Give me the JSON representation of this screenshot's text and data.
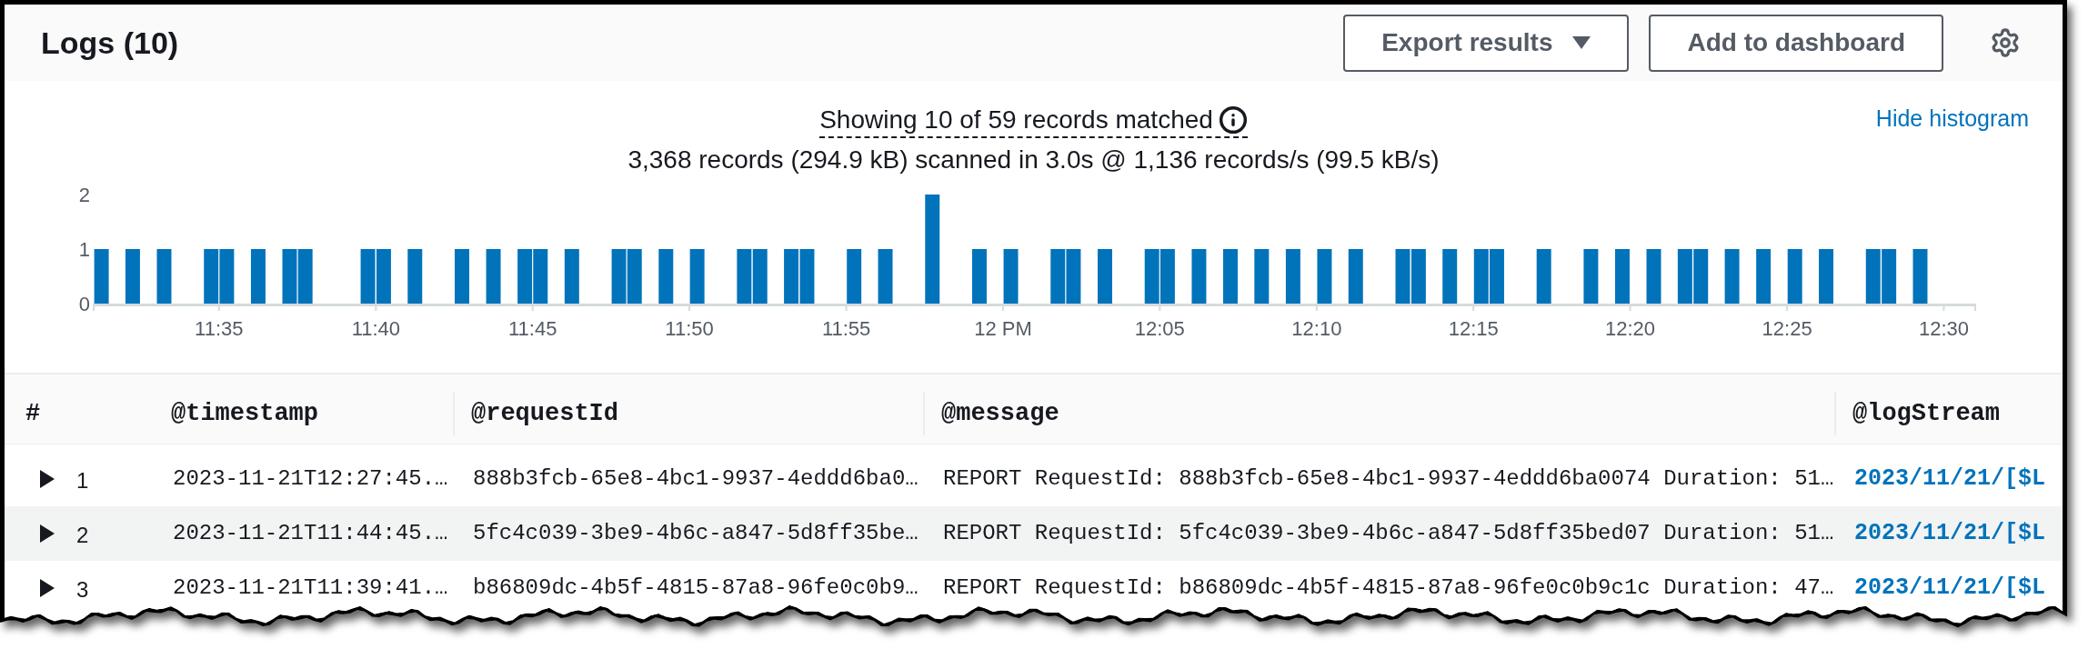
{
  "panel": {
    "title": "Logs (10)"
  },
  "toolbar": {
    "buttons": [
      {
        "label": "Export results",
        "kind": "dropdown"
      },
      {
        "label": "Add to dashboard",
        "kind": "action"
      }
    ]
  },
  "summary": {
    "matched": "Showing 10 of 59 records matched",
    "scan_stats": "3,368 records (294.9 kB) scanned in 3.0s @ 1,136 records/s (99.5 kB/s)",
    "histogram_toggle": "Hide histogram"
  },
  "histogram": {
    "chart_data": {
      "type": "bar",
      "x": [
        11.5167,
        11.5333,
        11.55,
        11.575,
        11.5833,
        11.6,
        11.6167,
        11.625,
        11.6583,
        11.6667,
        11.6833,
        11.7083,
        11.725,
        11.7417,
        11.75,
        11.7667,
        11.7917,
        11.8,
        11.8167,
        11.8333,
        11.8583,
        11.8667,
        11.8833,
        11.8917,
        11.9167,
        11.9333,
        11.9583,
        11.9833,
        12,
        12.025,
        12.0333,
        12.05,
        12.075,
        12.0833,
        12.1,
        12.1167,
        12.1333,
        12.15,
        12.1667,
        12.1833,
        12.2083,
        12.2167,
        12.2333,
        12.25,
        12.2583,
        12.2833,
        12.3083,
        12.325,
        12.3417,
        12.3583,
        12.3667,
        12.3833,
        12.4,
        12.4167,
        12.4333,
        12.4583,
        12.4667,
        12.4833
      ],
      "values": [
        1,
        1,
        1,
        1,
        1,
        1,
        1,
        1,
        1,
        1,
        1,
        1,
        1,
        1,
        1,
        1,
        1,
        1,
        1,
        1,
        1,
        1,
        1,
        1,
        1,
        1,
        2,
        1,
        1,
        1,
        1,
        1,
        1,
        1,
        1,
        1,
        1,
        1,
        1,
        1,
        1,
        1,
        1,
        1,
        1,
        1,
        1,
        1,
        1,
        1,
        1,
        1,
        1,
        1,
        1,
        1,
        1,
        1
      ],
      "xlim": [
        11.5167,
        12.5167
      ],
      "ylim": [
        0,
        2
      ],
      "yticks": [
        0,
        1,
        2
      ],
      "xticks": [
        {
          "value": 11.5833,
          "label": "11:35"
        },
        {
          "value": 11.6667,
          "label": "11:40"
        },
        {
          "value": 11.75,
          "label": "11:45"
        },
        {
          "value": 11.8333,
          "label": "11:50"
        },
        {
          "value": 11.9167,
          "label": "11:55"
        },
        {
          "value": 12,
          "label": "12 PM"
        },
        {
          "value": 12.0833,
          "label": "12:05"
        },
        {
          "value": 12.1667,
          "label": "12:10"
        },
        {
          "value": 12.25,
          "label": "12:15"
        },
        {
          "value": 12.3333,
          "label": "12:20"
        },
        {
          "value": 12.4167,
          "label": "12:25"
        },
        {
          "value": 12.5,
          "label": "12:30"
        }
      ]
    }
  },
  "table": {
    "columns": [
      "#",
      "@timestamp",
      "@requestId",
      "@message",
      "@logStream"
    ],
    "rows": [
      {
        "number": "1",
        "expanded": false,
        "timestamp": "2023-11-21T12:27:45.…",
        "request_id": "888b3fcb-65e8-4bc1-9937-4eddd6ba0…",
        "message": "REPORT RequestId: 888b3fcb-65e8-4bc1-9937-4eddd6ba0074 Duration: 51…",
        "log_stream": "2023/11/21/[$L"
      },
      {
        "number": "2",
        "expanded": false,
        "timestamp": "2023-11-21T11:44:45.…",
        "request_id": "5fc4c039-3be9-4b6c-a847-5d8ff35be…",
        "message": "REPORT RequestId: 5fc4c039-3be9-4b6c-a847-5d8ff35bed07 Duration: 51…",
        "log_stream": "2023/11/21/[$L"
      },
      {
        "number": "3",
        "expanded": false,
        "timestamp": "2023-11-21T11:39:41.…",
        "request_id": "b86809dc-4b5f-4815-87a8-96fe0c0b9…",
        "message": "REPORT RequestId: b86809dc-4b5f-4815-87a8-96fe0c0b9c1c Duration: 47…",
        "log_stream": "2023/11/21/[$L"
      }
    ]
  }
}
